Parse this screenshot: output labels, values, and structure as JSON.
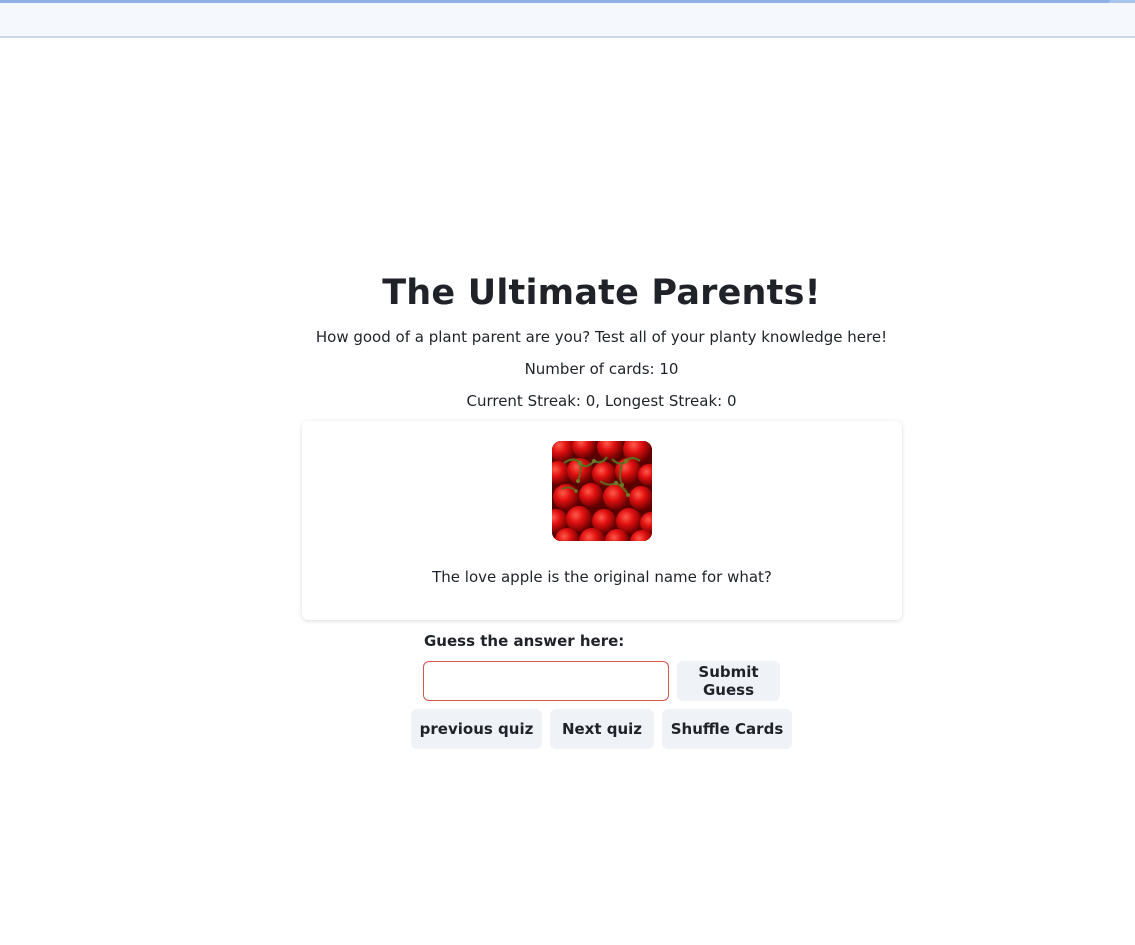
{
  "header": {
    "title": "The Ultimate Parents!",
    "subtitle": "How good of a plant parent are you? Test all of your planty knowledge here!",
    "card_count": "Number of cards: 10",
    "streak": "Current Streak: 0, Longest Streak: 0"
  },
  "card": {
    "image": "tomatoes-photo",
    "question": "The love apple is the original name for what?"
  },
  "guess": {
    "label": "Guess the answer here:",
    "value": "",
    "placeholder": "",
    "submit_label": "Submit Guess"
  },
  "nav": {
    "previous_label": "previous quiz",
    "next_label": "Next quiz",
    "shuffle_label": "Shuffle Cards"
  },
  "colors": {
    "input_border": "#d9534f",
    "button_bg": "#eff2f6",
    "text": "#1f2329"
  }
}
